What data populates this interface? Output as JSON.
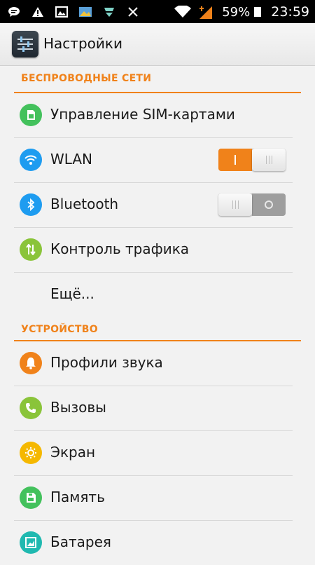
{
  "status_bar": {
    "battery": "59%",
    "time": "23:59",
    "icons": [
      "chat-icon",
      "warning-icon",
      "image-icon",
      "gallery-icon",
      "shield-icon",
      "usb-debug-icon"
    ],
    "right_icons": [
      "wifi-icon",
      "signal-icon",
      "battery-icon"
    ]
  },
  "action_bar": {
    "title": "Настройки"
  },
  "sections": {
    "wireless": {
      "header": "БЕСПРОВОДНЫЕ СЕТИ",
      "items": [
        {
          "label": "Управление SIM-картами",
          "icon": "sim-card-icon",
          "color": "#43c15c"
        },
        {
          "label": "WLAN",
          "icon": "wifi-icon",
          "color": "#1e9cf0",
          "toggle": true
        },
        {
          "label": "Bluetooth",
          "icon": "bluetooth-icon",
          "color": "#1e9cf0",
          "toggle": false
        },
        {
          "label": "Контроль трафика",
          "icon": "traffic-icon",
          "color": "#8ac43a"
        },
        {
          "label": "Ещё..."
        }
      ]
    },
    "device": {
      "header": "УСТРОЙСТВО",
      "items": [
        {
          "label": "Профили звука",
          "icon": "bell-icon",
          "color": "#f0821a"
        },
        {
          "label": "Вызовы",
          "icon": "phone-icon",
          "color": "#8ac43a"
        },
        {
          "label": "Экран",
          "icon": "brightness-icon",
          "color": "#f5b800"
        },
        {
          "label": "Память",
          "icon": "storage-icon",
          "color": "#43c15c"
        },
        {
          "label": "Батарея",
          "icon": "battery-stats-icon",
          "color": "#20b9b0"
        }
      ]
    }
  },
  "colors": {
    "accent": "#f0821a",
    "background": "#f2f2f2"
  }
}
